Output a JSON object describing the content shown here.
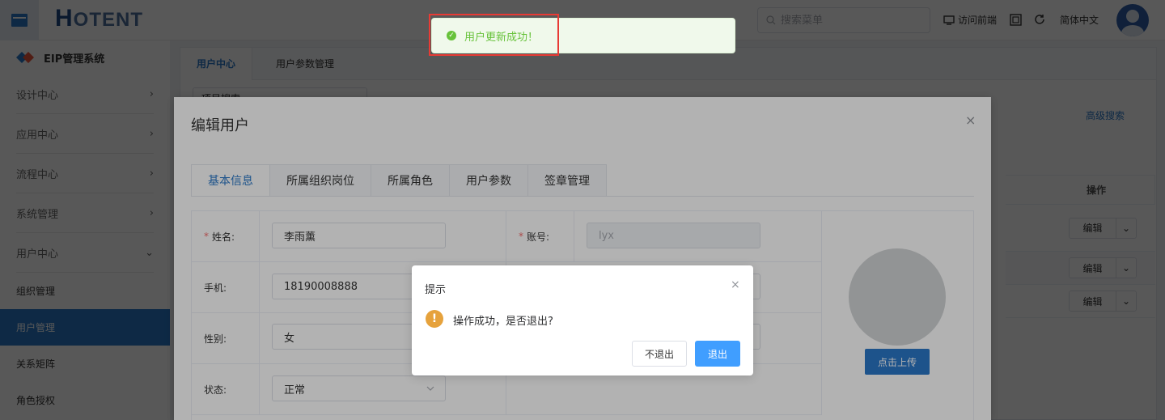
{
  "header": {
    "logo_main": "H",
    "logo_tail": "OTENT",
    "search_placeholder": "搜索菜单",
    "visit_frontend": "访问前端",
    "language": "简体中文"
  },
  "toast": {
    "message": "用户更新成功！",
    "color": "#67c23a"
  },
  "sidebar": {
    "system_title": "EIP管理系统",
    "groups": [
      "设计中心",
      "应用中心",
      "流程中心",
      "系统管理",
      "用户中心"
    ],
    "items": [
      "组织管理",
      "用户管理",
      "关系矩阵",
      "角色授权"
    ],
    "active_item": "用户管理",
    "accent": "#2a78c8"
  },
  "page": {
    "tabs": [
      "用户中心",
      "用户参数管理"
    ],
    "project_box": "项目搜索",
    "advanced_search": "高级搜索",
    "table_op_header": "操作",
    "row_edit_label": "编辑"
  },
  "edit_dialog": {
    "title": "编辑用户",
    "tabs": [
      "基本信息",
      "所属组织岗位",
      "所属角色",
      "用户参数",
      "签章管理"
    ],
    "fields": {
      "name_label": "姓名:",
      "name_value": "李雨薰",
      "account_label": "账号:",
      "account_value": "lyx",
      "phone_label": "手机:",
      "phone_value": "18190008888",
      "gender_label": "性别:",
      "gender_value": "女",
      "status_label": "状态:",
      "status_value": "正常"
    },
    "upload_label": "点击上传"
  },
  "confirm": {
    "title": "提示",
    "message": "操作成功，是否退出?",
    "cancel_label": "不退出",
    "ok_label": "退出",
    "ok_color": "#409eff",
    "warning_color": "#e6a23c"
  }
}
